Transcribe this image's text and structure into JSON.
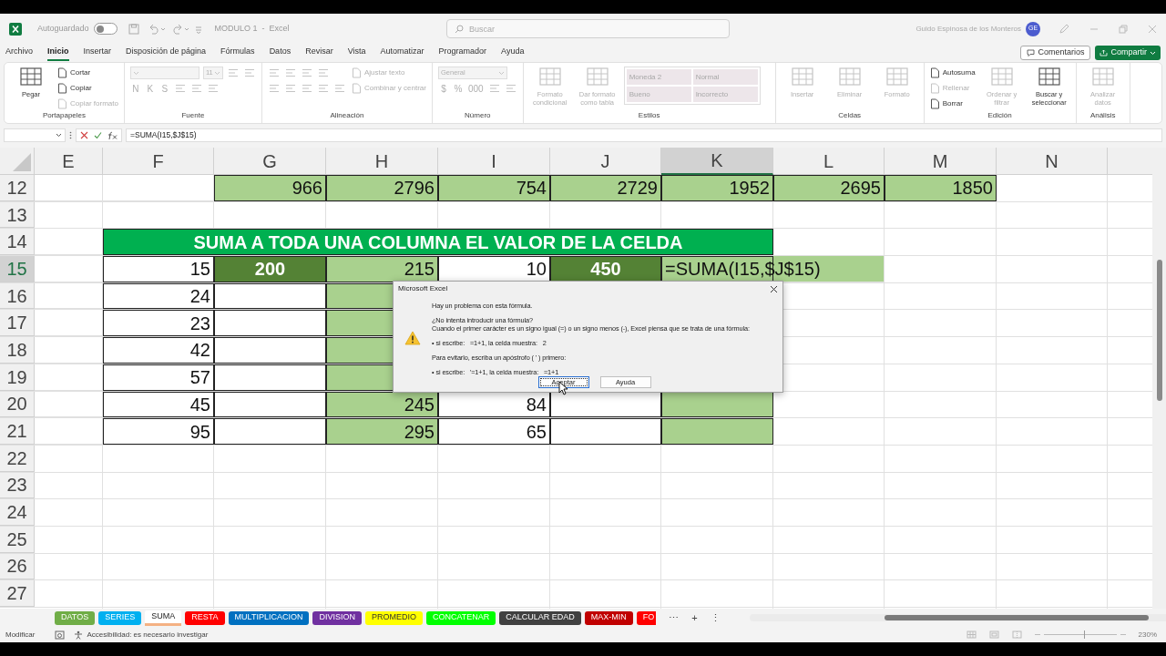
{
  "title_bar": {
    "autosave": {
      "label": "Autoguardado",
      "on": false
    },
    "document_title": "MODULO 1  -  Excel",
    "search": {
      "placeholder": "Buscar"
    },
    "user": {
      "name": "Guido Espinosa de los Monteros",
      "initials": "GE"
    }
  },
  "menu": {
    "tabs": [
      {
        "label": "Archivo",
        "selected": false
      },
      {
        "label": "Inicio",
        "selected": true
      },
      {
        "label": "Insertar",
        "selected": false
      },
      {
        "label": "Disposición de página",
        "selected": false
      },
      {
        "label": "Fórmulas",
        "selected": false
      },
      {
        "label": "Datos",
        "selected": false
      },
      {
        "label": "Revisar",
        "selected": false
      },
      {
        "label": "Vista",
        "selected": false
      },
      {
        "label": "Automatizar",
        "selected": false
      },
      {
        "label": "Programador",
        "selected": false
      },
      {
        "label": "Ayuda",
        "selected": false
      }
    ],
    "buttons": [
      {
        "label": "Comentarios",
        "kind": "outline"
      },
      {
        "label": "Compartir",
        "kind": "primary"
      }
    ]
  },
  "ribbon": {
    "groups": [
      {
        "label": "Portapapeles",
        "columns": [
          [
            [
              {
                "kind": "large",
                "label": "Pegar",
                "disabled": false
              }
            ]
          ],
          [
            [
              {
                "kind": "small",
                "label": "Cortar",
                "disabled": false
              }
            ],
            [
              {
                "kind": "small",
                "label": "Copiar",
                "disabled": false
              }
            ],
            [
              {
                "kind": "small",
                "label": "Copiar formato",
                "disabled": true
              }
            ]
          ]
        ]
      },
      {
        "label": "Fuente",
        "columns": [
          [
            [
              {
                "kind": "wide_field",
                "disabled": true
              },
              {
                "kind": "field",
                "value": "11",
                "disabled": true
              },
              {
                "kind": "icon",
                "disabled": true
              },
              {
                "kind": "icon",
                "disabled": true
              }
            ],
            [
              {
                "kind": "glyph",
                "label": "N",
                "disabled": true
              },
              {
                "kind": "glyph",
                "label": "K",
                "disabled": true
              },
              {
                "kind": "glyph",
                "label": "S",
                "disabled": true
              },
              {
                "kind": "icon",
                "disabled": true
              },
              {
                "kind": "icon",
                "disabled": true
              },
              {
                "kind": "icon",
                "disabled": true
              }
            ]
          ]
        ]
      },
      {
        "label": "Alineación",
        "columns": [
          [
            [
              {
                "kind": "icon",
                "disabled": true
              },
              {
                "kind": "icon",
                "disabled": true
              },
              {
                "kind": "icon",
                "disabled": true
              },
              {
                "kind": "icon",
                "disabled": true
              }
            ],
            [
              {
                "kind": "icon",
                "disabled": true
              },
              {
                "kind": "icon",
                "disabled": true
              },
              {
                "kind": "icon",
                "disabled": true
              },
              {
                "kind": "icon",
                "disabled": true
              },
              {
                "kind": "icon",
                "disabled": true
              }
            ]
          ],
          [
            [
              {
                "kind": "small",
                "label": "Ajustar texto",
                "disabled": true
              }
            ],
            [
              {
                "kind": "small",
                "label": "Combinar y centrar",
                "disabled": true
              }
            ]
          ]
        ]
      },
      {
        "label": "Número",
        "columns": [
          [
            [
              {
                "kind": "wide_field",
                "value": "General",
                "disabled": true
              }
            ],
            [
              {
                "kind": "glyph",
                "label": "$",
                "disabled": true
              },
              {
                "kind": "glyph",
                "label": "%",
                "disabled": true
              },
              {
                "kind": "glyph",
                "label": "000",
                "disabled": true
              },
              {
                "kind": "icon",
                "disabled": true
              },
              {
                "kind": "icon",
                "disabled": true
              }
            ]
          ]
        ]
      },
      {
        "label": "Estilos",
        "columns": [
          [
            [
              {
                "kind": "large",
                "label": "Formato condicional",
                "disabled": true
              }
            ]
          ],
          [
            [
              {
                "kind": "large",
                "label": "Dar formato como tabla",
                "disabled": true
              }
            ]
          ],
          [
            [
              {
                "kind": "gallery",
                "items": [
                  "Moneda 2",
                  "Normal",
                  "Bueno",
                  "Incorrecto"
                ]
              }
            ]
          ]
        ]
      },
      {
        "label": "Celdas",
        "columns": [
          [
            [
              {
                "kind": "large",
                "label": "Insertar",
                "disabled": true
              }
            ]
          ],
          [
            [
              {
                "kind": "large",
                "label": "Eliminar",
                "disabled": true
              }
            ]
          ],
          [
            [
              {
                "kind": "large",
                "label": "Formato",
                "disabled": true
              }
            ]
          ]
        ]
      },
      {
        "label": "Edición",
        "columns": [
          [
            [
              {
                "kind": "small",
                "label": "Autosuma",
                "disabled": false
              }
            ],
            [
              {
                "kind": "small",
                "label": "Rellenar",
                "disabled": true
              }
            ],
            [
              {
                "kind": "small",
                "label": "Borrar",
                "disabled": false
              }
            ]
          ],
          [
            [
              {
                "kind": "large",
                "label": "Ordenar y filtrar",
                "disabled": true
              }
            ]
          ],
          [
            [
              {
                "kind": "large",
                "label": "Buscar y seleccionar",
                "disabled": false
              }
            ]
          ]
        ]
      },
      {
        "label": "Análisis",
        "columns": [
          [
            [
              {
                "kind": "large",
                "label": "Analizar datos",
                "disabled": true
              }
            ]
          ]
        ]
      }
    ]
  },
  "formula_bar": {
    "formula": "=SUMA(I15,$J$15)"
  },
  "sheet": {
    "columns": [
      {
        "label": "E",
        "selected": false
      },
      {
        "label": "F",
        "selected": false
      },
      {
        "label": "G",
        "selected": false
      },
      {
        "label": "H",
        "selected": false
      },
      {
        "label": "I",
        "selected": false
      },
      {
        "label": "J",
        "selected": false
      },
      {
        "label": "K",
        "selected": true
      },
      {
        "label": "L",
        "selected": false
      },
      {
        "label": "M",
        "selected": false
      },
      {
        "label": "N",
        "selected": false
      }
    ],
    "rows": [
      {
        "number": "12",
        "selected": false,
        "cells": [
          {
            "bordered": false
          },
          {
            "bordered": false
          },
          {
            "text": "966",
            "kind": "number",
            "color": "#a9d18e",
            "bordered": true
          },
          {
            "text": "2796",
            "kind": "number",
            "color": "#a9d18e",
            "bordered": true
          },
          {
            "text": "754",
            "kind": "number",
            "color": "#a9d18e",
            "bordered": true
          },
          {
            "text": "2729",
            "kind": "number",
            "color": "#a9d18e",
            "bordered": true
          },
          {
            "text": "1952",
            "kind": "number",
            "color": "#a9d18e",
            "bordered": true
          },
          {
            "text": "2695",
            "kind": "number",
            "color": "#a9d18e",
            "bordered": true
          },
          {
            "text": "1850",
            "kind": "number",
            "color": "#a9d18e",
            "bordered": true
          }
        ]
      },
      {
        "number": "13",
        "selected": false
      },
      {
        "number": "14",
        "selected": false,
        "cells": [
          {
            "bordered": false
          },
          {
            "text": "SUMA A TODA UNA COLUMNA EL VALOR DE LA CELDA",
            "kind": "title",
            "color": "#00b050",
            "bordered": true
          }
        ]
      },
      {
        "number": "15",
        "selected": true,
        "cells": [
          {
            "bordered": false
          },
          {
            "text": "15",
            "kind": "number",
            "bordered": true
          },
          {
            "text": "200",
            "kind": "number",
            "color": "#548235",
            "bordered": true
          },
          {
            "text": "215",
            "kind": "number",
            "color": "#a9d18e",
            "bordered": true
          },
          {
            "text": "10",
            "kind": "number",
            "bordered": true
          },
          {
            "text": "450",
            "kind": "number",
            "color": "#548235",
            "bordered": true
          },
          {
            "text": "=SUMA(I15,$J$15)",
            "kind": "text",
            "color": "#a9d18e",
            "bordered": true
          },
          {
            "color": "#a9d18e",
            "bordered": false
          }
        ]
      },
      {
        "number": "16",
        "selected": false,
        "cells": [
          {
            "bordered": false
          },
          {
            "text": "24",
            "kind": "number",
            "bordered": true
          },
          {
            "bordered": true
          },
          {
            "color": "#a9d18e",
            "bordered": true
          }
        ]
      },
      {
        "number": "17",
        "selected": false,
        "cells": [
          {
            "bordered": false
          },
          {
            "text": "23",
            "kind": "number",
            "bordered": true
          },
          {
            "bordered": true
          },
          {
            "color": "#a9d18e",
            "bordered": true
          }
        ]
      },
      {
        "number": "18",
        "selected": false,
        "cells": [
          {
            "bordered": false
          },
          {
            "text": "42",
            "kind": "number",
            "bordered": true
          },
          {
            "bordered": true
          },
          {
            "color": "#a9d18e",
            "bordered": true
          }
        ]
      },
      {
        "number": "19",
        "selected": false,
        "cells": [
          {
            "bordered": false
          },
          {
            "text": "57",
            "kind": "number",
            "bordered": true
          },
          {
            "bordered": true
          },
          {
            "color": "#a9d18e",
            "bordered": true
          }
        ]
      },
      {
        "number": "20",
        "selected": false,
        "cells": [
          {
            "bordered": false
          },
          {
            "text": "45",
            "kind": "number",
            "bordered": true
          },
          {
            "bordered": true
          },
          {
            "text": "245",
            "kind": "number",
            "color": "#a9d18e",
            "bordered": true
          },
          {
            "text": "84",
            "kind": "number",
            "bordered": true
          },
          {
            "bordered": true
          },
          {
            "color": "#a9d18e",
            "bordered": true
          }
        ]
      },
      {
        "number": "21",
        "selected": false,
        "cells": [
          {
            "bordered": false
          },
          {
            "text": "95",
            "kind": "number",
            "bordered": true
          },
          {
            "bordered": true
          },
          {
            "text": "295",
            "kind": "number",
            "color": "#a9d18e",
            "bordered": true
          },
          {
            "text": "65",
            "kind": "number",
            "bordered": true
          },
          {
            "bordered": true
          },
          {
            "color": "#a9d18e",
            "bordered": true
          }
        ]
      },
      {
        "number": "22",
        "selected": false
      },
      {
        "number": "23",
        "selected": false
      },
      {
        "number": "24",
        "selected": false
      },
      {
        "number": "25",
        "selected": false
      },
      {
        "number": "26",
        "selected": false
      },
      {
        "number": "27",
        "selected": false
      }
    ]
  },
  "dialog": {
    "title": "Microsoft Excel",
    "lines": [
      {
        "text": "Hay un problema con esta fórmula.",
        "kind": "paragraph"
      },
      {
        "text": "¿No intenta introducir una fórmula?",
        "kind": "paragraph"
      },
      {
        "text": "Cuando el primer carácter es un signo igual (=) o un signo menos (-), Excel piensa que se trata de una fórmula:",
        "kind": "continued"
      },
      {
        "text": "• si escribe:   =1+1, la celda muestra:   2",
        "kind": "paragraph"
      },
      {
        "text": "Para evitarlo, escriba un apóstrofo ( ' ) primero:",
        "kind": "paragraph"
      },
      {
        "text": "• si escribe:   '=1+1, la celda muestra:   =1+1",
        "kind": "paragraph"
      }
    ],
    "buttons": [
      {
        "label": "Aceptar",
        "focused": true
      },
      {
        "label": "Ayuda",
        "focused": false
      }
    ]
  },
  "sheet_tabs": {
    "tabs": [
      {
        "label": "DATOS",
        "color": "#70ad47",
        "selected": false
      },
      {
        "label": "SERIES",
        "color": "#00b0f0",
        "selected": false
      },
      {
        "label": "SUMA",
        "color": "#f4b183",
        "selected": true
      },
      {
        "label": "RESTA",
        "color": "#ff0000",
        "selected": false
      },
      {
        "label": "MULTIPLICACION",
        "color": "#0070c0",
        "selected": false
      },
      {
        "label": "DIVISION",
        "color": "#7030a0",
        "selected": false
      },
      {
        "label": "PROMEDIO",
        "color": "#ffff00",
        "selected": false
      },
      {
        "label": "CONCATENAR",
        "color": "#00ff00",
        "selected": false
      },
      {
        "label": "CALCULAR EDAD",
        "color": "#404040",
        "selected": false
      },
      {
        "label": "MAX-MIN",
        "color": "#c00000",
        "selected": false
      },
      {
        "label": "FO",
        "color": "#ff0000",
        "selected": false
      }
    ],
    "controls": [
      "⋯",
      "+",
      "⋮"
    ]
  },
  "status_bar": {
    "mode": "Modificar",
    "accessibility": "Accesibilidad: es necesario investigar",
    "zoom": {
      "level": 0.55,
      "reading": "230%"
    }
  }
}
